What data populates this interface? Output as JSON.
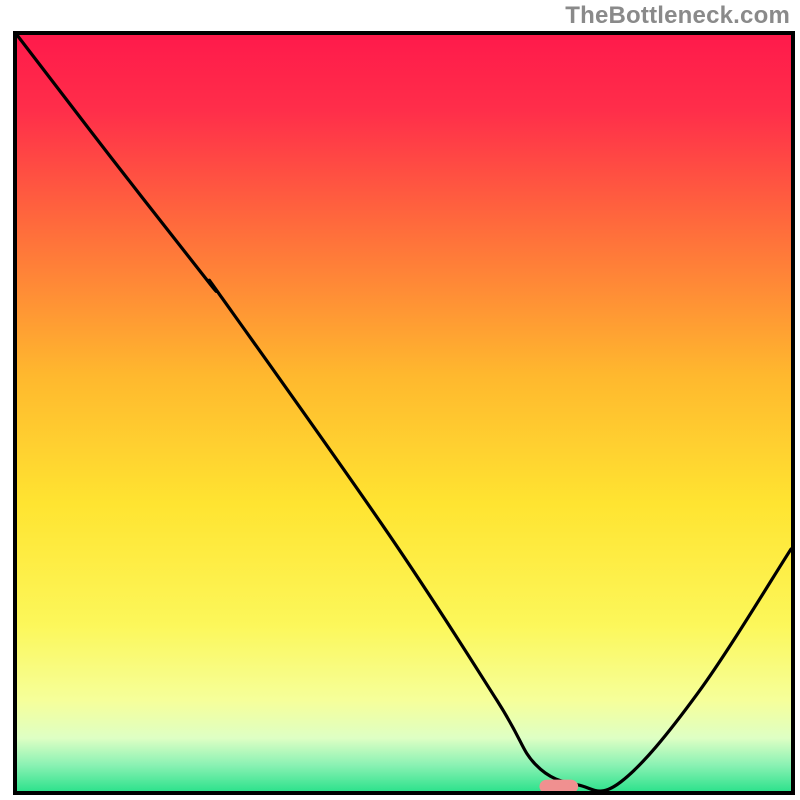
{
  "watermark": "TheBottleneck.com",
  "chart_data": {
    "type": "line",
    "title": "",
    "xlabel": "",
    "ylabel": "",
    "xlim": [
      0,
      100
    ],
    "ylim": [
      0,
      100
    ],
    "grid": false,
    "legend": false,
    "background_gradient": {
      "stops": [
        {
          "offset": 0.0,
          "color": "#ff1a4b"
        },
        {
          "offset": 0.1,
          "color": "#ff2e4a"
        },
        {
          "offset": 0.25,
          "color": "#ff6a3c"
        },
        {
          "offset": 0.45,
          "color": "#ffb82e"
        },
        {
          "offset": 0.62,
          "color": "#ffe431"
        },
        {
          "offset": 0.78,
          "color": "#fcf75a"
        },
        {
          "offset": 0.88,
          "color": "#f6ff9a"
        },
        {
          "offset": 0.93,
          "color": "#deffc4"
        },
        {
          "offset": 0.965,
          "color": "#8cf2b4"
        },
        {
          "offset": 1.0,
          "color": "#2fe28d"
        }
      ]
    },
    "series": [
      {
        "name": "bottleneck-curve",
        "color": "#000000",
        "x": [
          0.0,
          12.0,
          25.0,
          26.5,
          48.0,
          62.0,
          67.0,
          72.5,
          78.0,
          88.0,
          100.0
        ],
        "y": [
          100.0,
          84.0,
          67.0,
          65.2,
          34.0,
          12.0,
          3.5,
          0.8,
          1.2,
          13.0,
          32.0
        ]
      }
    ],
    "marker": {
      "name": "optimal-point",
      "x": 70.0,
      "y": 0.6,
      "color": "#f09090",
      "width_frac": 0.05,
      "height_frac": 0.018,
      "rx_frac": 0.01
    }
  }
}
